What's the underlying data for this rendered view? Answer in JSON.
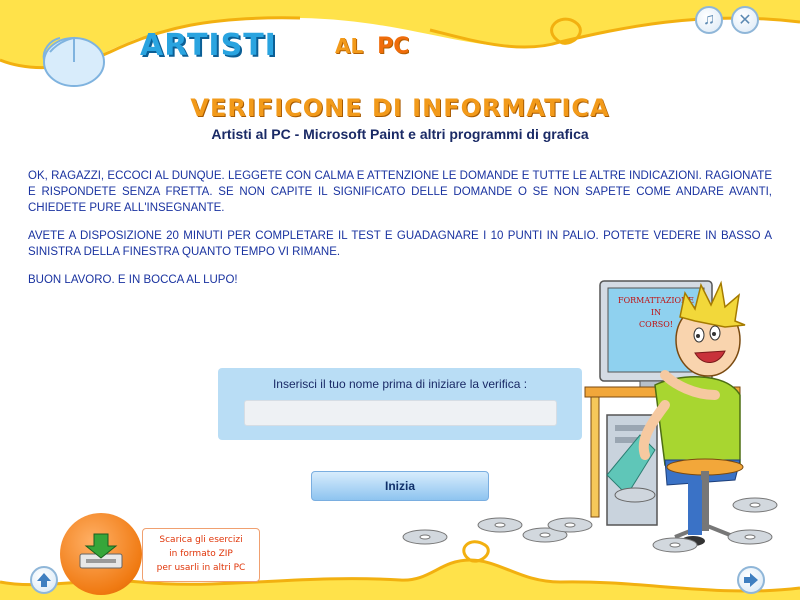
{
  "header": {
    "logo_main": "ARTISTI",
    "logo_al": "AL",
    "logo_pc": "PC",
    "audio_icon": "music-note-icon",
    "close_icon": "close-icon"
  },
  "page": {
    "title": "VERIFICONE DI INFORMATICA",
    "subtitle": "Artisti al PC - Microsoft Paint e altri programmi di grafica",
    "paragraphs": [
      "OK, RAGAZZI, ECCOCI AL DUNQUE. LEGGETE CON CALMA E ATTENZIONE LE DOMANDE E TUTTE LE ALTRE INDICAZIONI. RAGIONATE E RISPONDETE SENZA FRETTA. SE NON CAPITE IL SIGNIFICATO DELLE DOMANDE O SE NON SAPETE COME ANDARE AVANTI, CHIEDETE PURE ALL'INSEGNANTE.",
      "AVETE A DISPOSIZIONE 20 MINUTI PER COMPLETARE IL TEST E GUADAGNARE I 10 PUNTI IN PALIO. POTETE VEDERE IN BASSO A SINISTRA DELLA FINESTRA QUANTO TEMPO VI RIMANE.",
      "BUON LAVORO. E IN BOCCA AL LUPO!"
    ]
  },
  "form": {
    "label": "Inserisci il tuo nome prima di iniziare la verifica :",
    "input_value": "",
    "start_label": "Inizia"
  },
  "illustration": {
    "screen_text": [
      "FORMATTAZIONE",
      "IN",
      "CORSO!"
    ]
  },
  "download": {
    "icon": "download-icon",
    "lines": [
      "Scarica gli esercizi",
      "in formato ZIP",
      "per usarli in altri PC"
    ]
  },
  "nav": {
    "prev_icon": "arrow-up-icon",
    "next_icon": "arrow-right-icon"
  },
  "colors": {
    "accent_orange": "#f29a1a",
    "accent_blue": "#2aa4e0",
    "text_blue": "#1a33a0",
    "band_yellow": "#ffe24a"
  }
}
